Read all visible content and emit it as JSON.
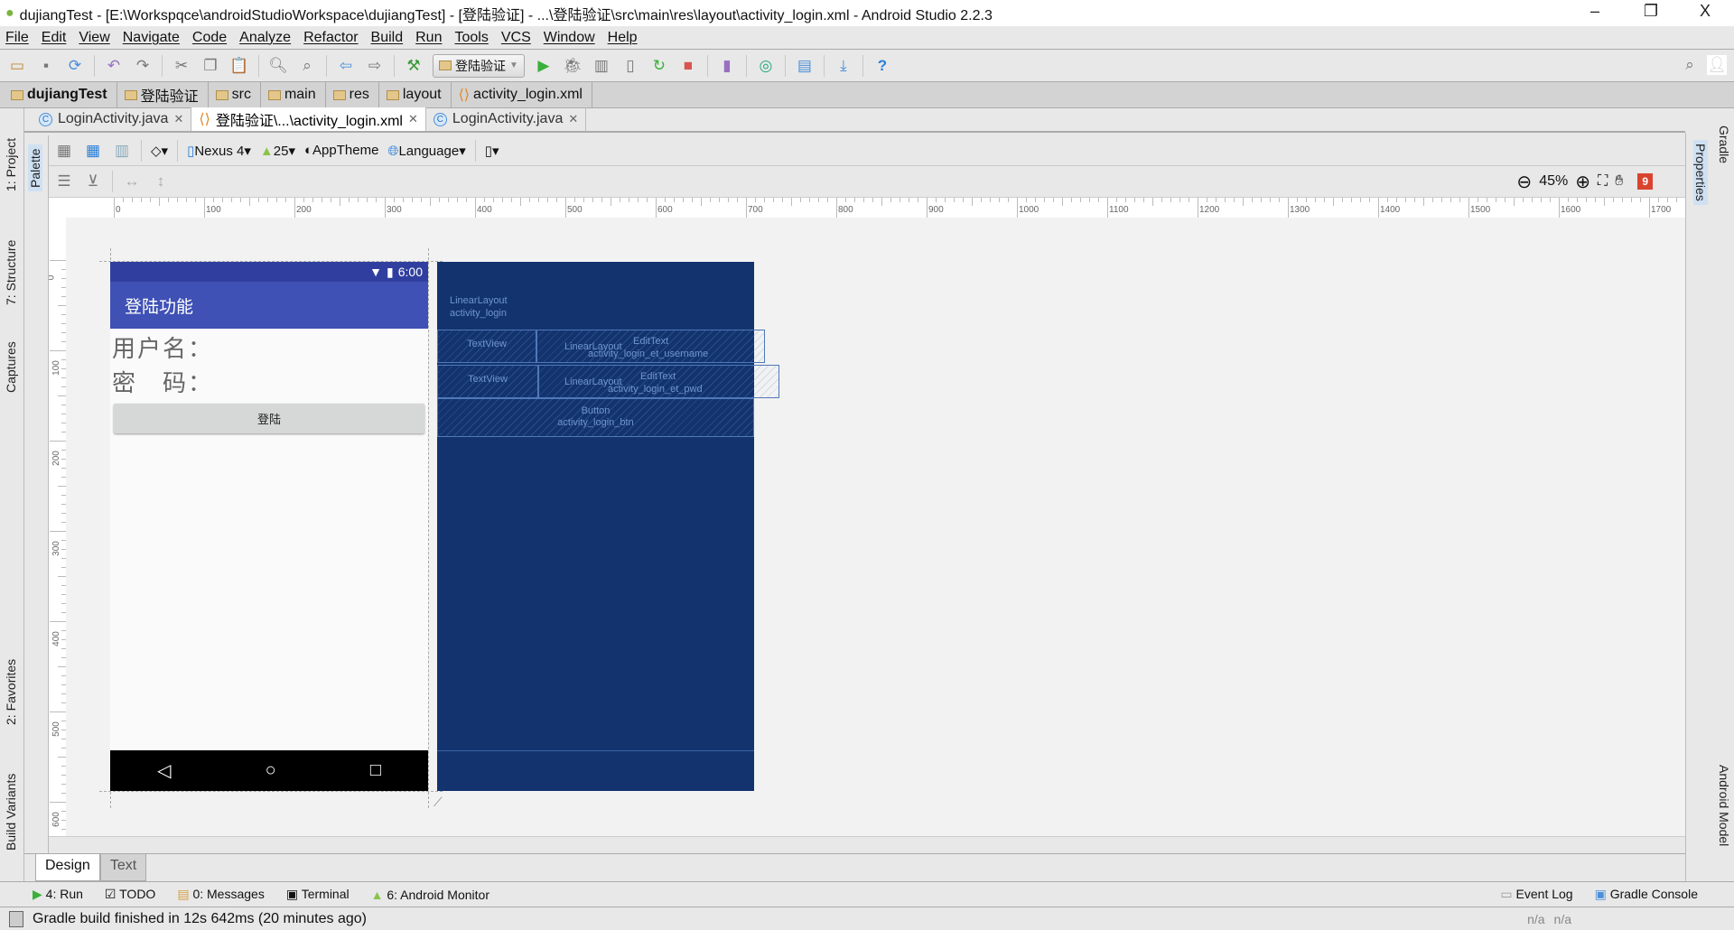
{
  "window": {
    "title": "dujiangTest - [E:\\Workspqce\\androidStudioWorkspace\\dujiangTest] - [登陆验证] - ...\\登陆验证\\src\\main\\res\\layout\\activity_login.xml - Android Studio 2.2.3",
    "minimize": "–",
    "restore": "❐",
    "close": "X"
  },
  "menu": [
    "File",
    "Edit",
    "View",
    "Navigate",
    "Code",
    "Analyze",
    "Refactor",
    "Build",
    "Run",
    "Tools",
    "VCS",
    "Window",
    "Help"
  ],
  "toolbar": {
    "run_config": "登陆验证"
  },
  "breadcrumb": [
    "dujiangTest",
    "登陆验证",
    "src",
    "main",
    "res",
    "layout",
    "activity_login.xml"
  ],
  "tabs": [
    {
      "label": "LoginActivity.java",
      "active": false
    },
    {
      "label": "登陆验证\\...\\activity_login.xml",
      "active": true
    },
    {
      "label": "LoginActivity.java",
      "active": false
    }
  ],
  "design_toolbar": {
    "device": "Nexus 4",
    "api": "25",
    "theme": "AppTheme",
    "language": "Language",
    "zoom": "45%",
    "issues": "9"
  },
  "left_tools": [
    "1: Project",
    "7: Structure",
    "Captures",
    "2: Favorites",
    "Build Variants"
  ],
  "palette": "Palette",
  "right_tools": {
    "gradle": "Gradle",
    "properties": "Properties",
    "android_model": "Android Model"
  },
  "ruler": {
    "top": [
      "0",
      "100",
      "200",
      "300",
      "400",
      "500",
      "600",
      "700",
      "800",
      "900",
      "1000",
      "1100",
      "1200",
      "1300",
      "1400",
      "1500",
      "1600",
      "1700"
    ],
    "left": [
      "0",
      "100",
      "200",
      "300",
      "400",
      "500",
      "600"
    ]
  },
  "phone": {
    "time": "6:00",
    "app_title": "登陆功能",
    "username_label": "用户名：",
    "password_label": "密　码：",
    "login_button": "登陆"
  },
  "blueprint": {
    "root": "LinearLayout",
    "root_id": "activity_login",
    "tv1": "TextView",
    "ll1": "LinearLayout",
    "et1": "EditText",
    "et1_id": "activity_login_et_username",
    "tv2": "TextView",
    "ll2": "LinearLayout",
    "et2": "EditText",
    "et2_id": "activity_login_et_pwd",
    "btn": "Button",
    "btn_id": "activity_login_btn"
  },
  "design_tabs": [
    {
      "label": "Design",
      "active": true
    },
    {
      "label": "Text",
      "active": false
    }
  ],
  "tool_windows": [
    "4: Run",
    "TODO",
    "0: Messages",
    "Terminal",
    "6: Android Monitor"
  ],
  "tool_windows_right": [
    "Event Log",
    "Gradle Console"
  ],
  "status": {
    "message": "Gradle build finished in 12s 642ms (20 minutes ago)",
    "pos1": "n/a",
    "pos2": "n/a"
  },
  "colors": {
    "status_bar": "#303f9f",
    "app_bar": "#3f51b5",
    "blueprint": "#13336f"
  }
}
